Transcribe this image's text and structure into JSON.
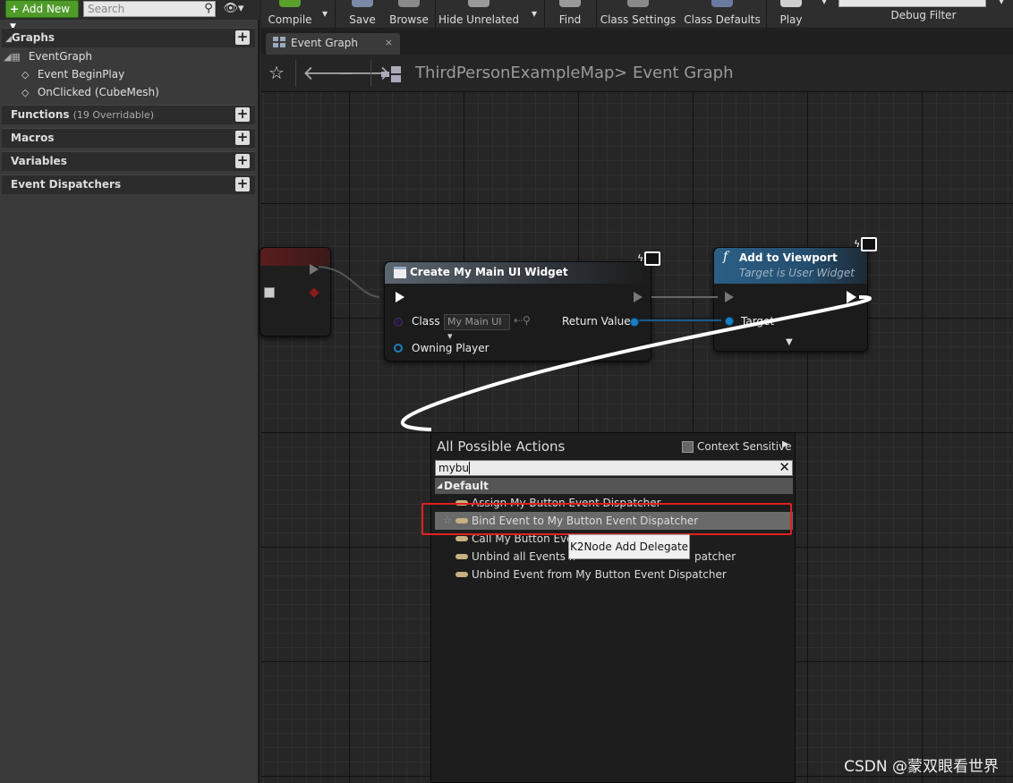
{
  "left_panel": {
    "add_new": "Add New",
    "search_placeholder": "Search",
    "categories": [
      {
        "label": "Graphs",
        "sub": ""
      },
      {
        "label": "Functions",
        "sub": "(19 Overridable)"
      },
      {
        "label": "Macros",
        "sub": ""
      },
      {
        "label": "Variables",
        "sub": ""
      },
      {
        "label": "Event Dispatchers",
        "sub": ""
      }
    ],
    "graph_items": [
      "EventGraph",
      "Event BeginPlay",
      "OnClicked (CubeMesh)"
    ]
  },
  "toolbar": {
    "compile": "Compile",
    "save": "Save",
    "browse": "Browse",
    "hide_unrelated": "Hide Unrelated",
    "find": "Find",
    "class_settings": "Class Settings",
    "class_defaults": "Class Defaults",
    "play": "Play",
    "debug_filter": "Debug Filter"
  },
  "tab": {
    "label": "Event Graph",
    "close": "×"
  },
  "breadcrumb": {
    "map": "ThirdPersonExampleMap",
    "separator": ">",
    "graph": "Event Graph"
  },
  "nodes": {
    "create_widget": {
      "title": "Create My Main UI Widget",
      "class_label": "Class",
      "class_value": "My Main UI",
      "return_value": "Return Value",
      "owning_player": "Owning Player"
    },
    "add_to_viewport": {
      "title": "Add to Viewport",
      "subtitle": "Target is User Widget",
      "target": "Target",
      "func_symbol": "f"
    }
  },
  "action_menu": {
    "title": "All Possible Actions",
    "context_sensitive": "Context Sensitive",
    "search_value": "mybu",
    "category": "Default",
    "items": [
      "Assign My Button Event Dispatcher",
      "Bind Event to My Button Event Dispatcher",
      "Call My Button Eve",
      "Unbind all Events fi",
      "Unbind Event from My Button Event Dispatcher"
    ],
    "item4_tail": "patcher",
    "tooltip": "K2Node Add Delegate"
  },
  "watermark": "CSDN @蒙双眼看世界",
  "colors": {
    "add_new_green": "#4e9b2a",
    "highlight_red": "#e02020",
    "wire_white": "#ffffff",
    "object_pin_blue": "#1a7fc0"
  }
}
